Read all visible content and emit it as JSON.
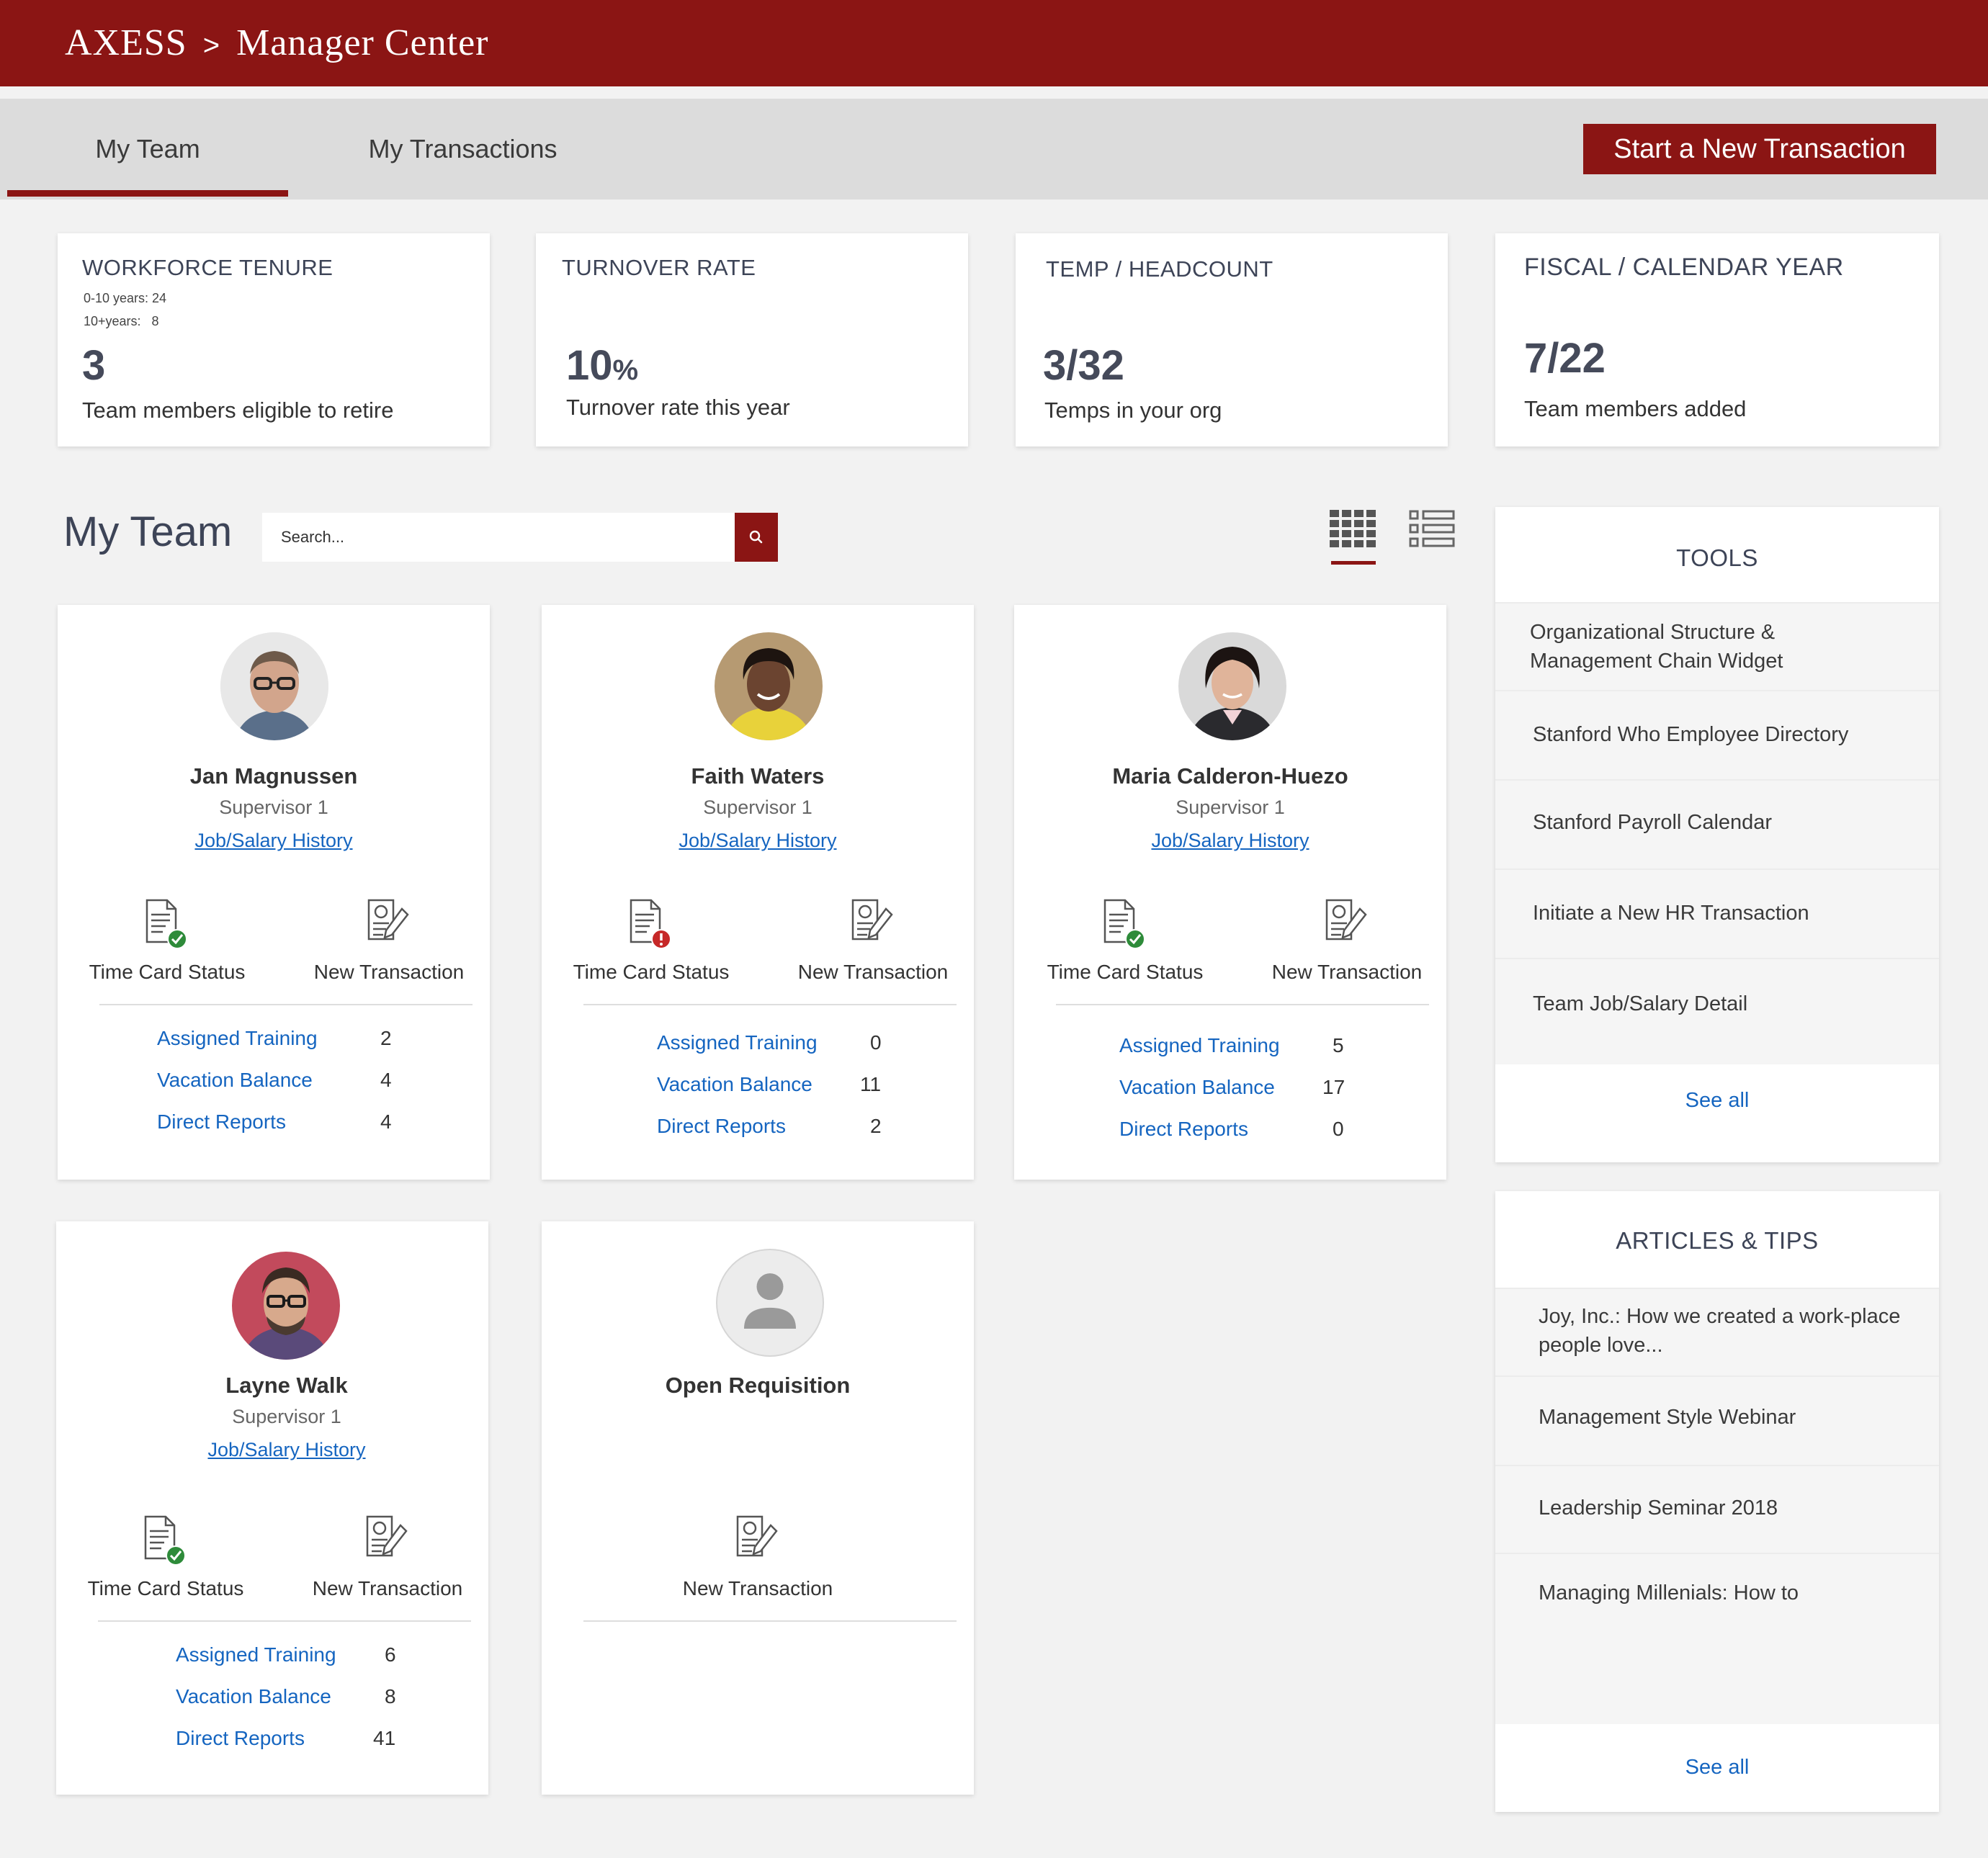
{
  "header": {
    "app_name": "AXESS",
    "separator": ">",
    "section": "Manager Center"
  },
  "tabs": [
    {
      "label": "My Team",
      "active": true
    },
    {
      "label": "My Transactions",
      "active": false
    }
  ],
  "new_transaction_button": "Start a New Transaction",
  "stats": [
    {
      "title": "WORKFORCE TENURE",
      "details": [
        "0-10 years: 24",
        "10+years:   8"
      ],
      "value": "3",
      "description": "Team members eligible to retire"
    },
    {
      "title": "TURNOVER RATE",
      "value": "10",
      "unit": "%",
      "description": "Turnover rate this year"
    },
    {
      "title": "TEMP / HEADCOUNT",
      "value": "3/32",
      "description": "Temps in your org"
    },
    {
      "title": "FISCAL / CALENDAR YEAR",
      "value": "7/22",
      "description": "Team members added"
    }
  ],
  "team": {
    "title": "My Team",
    "search_placeholder": "Search...",
    "members": [
      {
        "name": "Jan Magnussen",
        "role": "Supervisor 1",
        "link": "Job/Salary History",
        "time_card_status": "ok",
        "actions": {
          "time_card": "Time Card Status",
          "new_transaction": "New Transaction"
        },
        "metrics": [
          {
            "label": "Assigned  Training",
            "value": "2"
          },
          {
            "label": "Vacation Balance",
            "value": "4"
          },
          {
            "label": "Direct Reports",
            "value": "4"
          }
        ]
      },
      {
        "name": "Faith Waters",
        "role": "Supervisor 1",
        "link": "Job/Salary History",
        "time_card_status": "error",
        "actions": {
          "time_card": "Time Card Status",
          "new_transaction": "New Transaction"
        },
        "metrics": [
          {
            "label": "Assigned  Training",
            "value": "0"
          },
          {
            "label": "Vacation Balance",
            "value": "11"
          },
          {
            "label": "Direct Reports",
            "value": "2"
          }
        ]
      },
      {
        "name": "Maria Calderon-Huezo",
        "role": "Supervisor 1",
        "link": "Job/Salary History",
        "time_card_status": "ok",
        "actions": {
          "time_card": "Time Card Status",
          "new_transaction": "New Transaction"
        },
        "metrics": [
          {
            "label": "Assigned  Training",
            "value": "5"
          },
          {
            "label": "Vacation Balance",
            "value": "17"
          },
          {
            "label": "Direct Reports",
            "value": "0"
          }
        ]
      },
      {
        "name": "Layne Walk",
        "role": "Supervisor 1",
        "link": "Job/Salary History",
        "time_card_status": "ok",
        "actions": {
          "time_card": "Time Card Status",
          "new_transaction": "New Transaction"
        },
        "metrics": [
          {
            "label": "Assigned  Training",
            "value": "6"
          },
          {
            "label": "Vacation Balance",
            "value": "8"
          },
          {
            "label": "Direct Reports",
            "value": "41"
          }
        ]
      }
    ],
    "open_requisition": {
      "name": "Open Requisition",
      "action": "New Transaction"
    }
  },
  "tools": {
    "title": "TOOLS",
    "items": [
      "Organizational Structure &\nManagement Chain Widget",
      "Stanford Who Employee Directory",
      "Stanford Payroll Calendar",
      "Initiate a New HR Transaction",
      "Team Job/Salary Detail"
    ],
    "see_all": "See all"
  },
  "articles": {
    "title": "ARTICLES & TIPS",
    "items": [
      "Joy, Inc.: How we created a work-place\npeople love...",
      "Management Style Webinar",
      "Leadership Seminar 2018",
      "Managing Millenials: How to"
    ],
    "see_all": "See all"
  },
  "icons": {
    "search": "search-icon",
    "grid_view": "grid-view-icon",
    "list_view": "list-view-icon",
    "time_card": "document-icon",
    "new_transaction": "document-edit-icon",
    "status_ok": "check-circle-icon",
    "status_error": "exclamation-circle-icon",
    "placeholder_avatar": "person-icon"
  },
  "colors": {
    "brand": "#8b1514",
    "link": "#1565c0",
    "ok": "#2e8b3a",
    "error": "#c62828"
  }
}
